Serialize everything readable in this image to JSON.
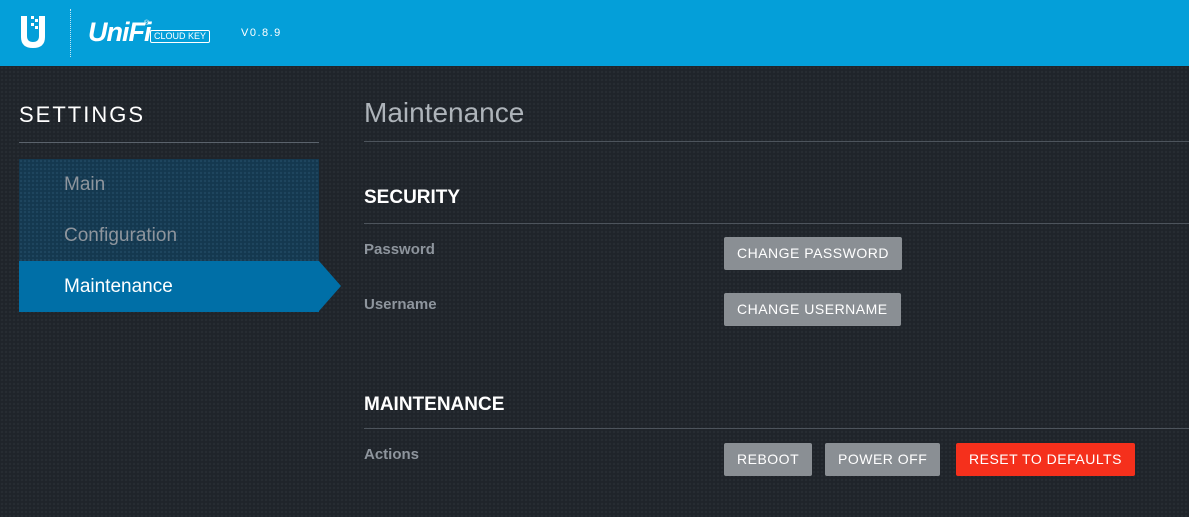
{
  "header": {
    "brand": "UniFi",
    "brand_mark": "®",
    "product_badge": "CLOUD KEY",
    "version": "V0.8.9",
    "logo_icon": "ubiquiti-u-logo",
    "bar_color": "#049fd9"
  },
  "sidebar": {
    "title": "SETTINGS",
    "items": [
      {
        "label": "Main",
        "active": false
      },
      {
        "label": "Configuration",
        "active": false
      },
      {
        "label": "Maintenance",
        "active": true
      }
    ],
    "active_color": "#006fa7"
  },
  "content": {
    "page_title": "Maintenance",
    "security": {
      "title": "SECURITY",
      "password_label": "Password",
      "change_password_label": "CHANGE PASSWORD",
      "username_label": "Username",
      "change_username_label": "CHANGE USERNAME"
    },
    "maintenance": {
      "title": "MAINTENANCE",
      "actions_label": "Actions",
      "reboot_label": "REBOOT",
      "power_off_label": "POWER OFF",
      "reset_label": "RESET TO DEFAULTS",
      "danger_color": "#f5301c"
    }
  }
}
